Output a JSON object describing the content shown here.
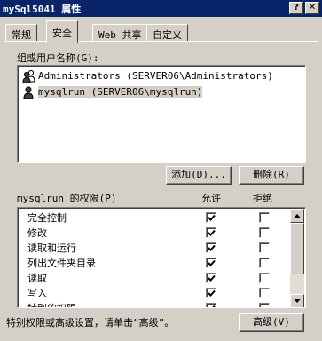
{
  "window": {
    "title": "mySql5041 属性",
    "help_glyph": "?",
    "close_glyph": "✕"
  },
  "tabs": [
    {
      "label": "常规",
      "active": false
    },
    {
      "label": "安全",
      "active": true
    },
    {
      "label": "Web 共享",
      "active": false
    },
    {
      "label": "自定义",
      "active": false
    }
  ],
  "security": {
    "users_label": "组或用户名称(G):",
    "users": [
      {
        "icon": "group-icon",
        "name": "Administrators (SERVER06\\Administrators)",
        "selected": false
      },
      {
        "icon": "user-icon",
        "name": "mysqlrun (SERVER06\\mysqlrun)",
        "selected": true
      }
    ],
    "add_button": "添加(D)...",
    "remove_button": "删除(R)",
    "permissions_label": "mysqlrun 的权限(P)",
    "allow_header": "允许",
    "deny_header": "拒绝",
    "permissions": [
      {
        "name": "完全控制",
        "allow": true,
        "deny": false
      },
      {
        "name": "修改",
        "allow": true,
        "deny": false
      },
      {
        "name": "读取和运行",
        "allow": true,
        "deny": false
      },
      {
        "name": "列出文件夹目录",
        "allow": true,
        "deny": false
      },
      {
        "name": "读取",
        "allow": true,
        "deny": false
      },
      {
        "name": "写入",
        "allow": true,
        "deny": false
      },
      {
        "name": "特别的权限",
        "allow": true,
        "deny": false
      }
    ],
    "advanced_hint": "特别权限或高级设置，请单击“高级”。",
    "advanced_button": "高级(V)"
  }
}
